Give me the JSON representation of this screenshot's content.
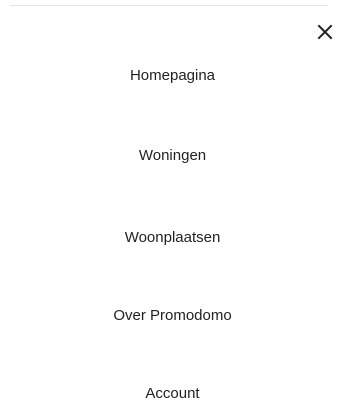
{
  "menu": {
    "close_icon": "close-icon",
    "items": [
      {
        "label": "Homepagina"
      },
      {
        "label": "Woningen"
      },
      {
        "label": "Woonplaatsen"
      },
      {
        "label": "Over Promodomo"
      },
      {
        "label": "Account"
      }
    ]
  },
  "colors": {
    "text": "#222222",
    "background": "#ffffff",
    "divider": "#e6e6e6"
  }
}
